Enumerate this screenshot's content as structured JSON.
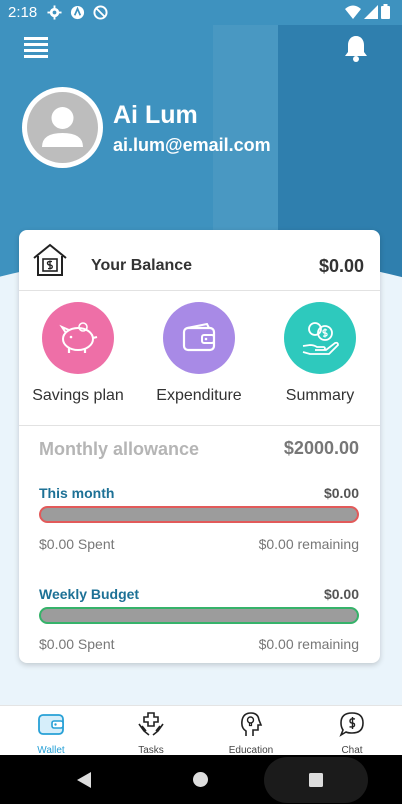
{
  "status_bar": {
    "time": "2:18"
  },
  "profile": {
    "name": "Ai Lum",
    "email": "ai.lum@email.com"
  },
  "balance": {
    "label": "Your Balance",
    "value": "$0.00"
  },
  "actions": [
    {
      "label": "Savings plan",
      "color": "#ee6fa7",
      "icon": "piggy-bank-icon"
    },
    {
      "label": "Expenditure",
      "color": "#a88ae6",
      "icon": "wallet-icon"
    },
    {
      "label": "Summary",
      "color": "#2ec9bd",
      "icon": "money-hand-icon"
    }
  ],
  "allowance": {
    "label": "Monthly allowance",
    "value": "$2000.00"
  },
  "this_month": {
    "title": "This month",
    "value": "$0.00",
    "spent": "$0.00 Spent",
    "remaining": "$0.00 remaining",
    "progress": 0
  },
  "weekly_budget": {
    "title": "Weekly Budget",
    "value": "$0.00",
    "spent": "$0.00 Spent",
    "remaining": "$0.00 remaining",
    "progress": 0
  },
  "bottom_nav": [
    {
      "label": "Wallet",
      "icon": "wallet-icon",
      "active": true
    },
    {
      "label": "Tasks",
      "icon": "tasks-hands-icon",
      "active": false
    },
    {
      "label": "Education",
      "icon": "head-idea-icon",
      "active": false
    },
    {
      "label": "Chat",
      "icon": "chat-dollar-icon",
      "active": false
    }
  ],
  "colors": {
    "header": "#3e92bf",
    "accent": "#27a0d6",
    "title_blue": "#1d7196"
  }
}
